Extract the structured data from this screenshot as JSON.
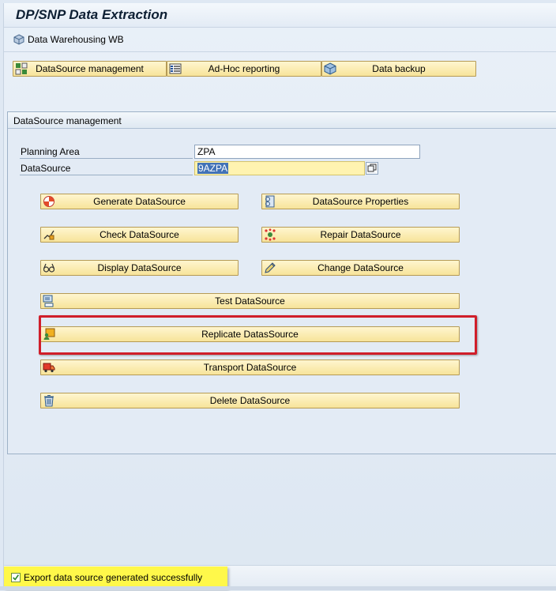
{
  "window": {
    "title": "DP/SNP Data Extraction"
  },
  "app_toolbar": {
    "dwb_label": "Data Warehousing WB"
  },
  "tabs": [
    {
      "label": "DataSource management",
      "icon": "datasource-management-icon"
    },
    {
      "label": "Ad-Hoc reporting",
      "icon": "report-list-icon"
    },
    {
      "label": "Data backup",
      "icon": "cube-icon"
    }
  ],
  "frame": {
    "title": "DataSource management",
    "planning_area": {
      "label": "Planning Area",
      "value": "ZPA"
    },
    "datasource": {
      "label": "DataSource",
      "value": "9AZPA"
    }
  },
  "buttons": {
    "generate": "Generate DataSource",
    "properties": "DataSource Properties",
    "check": "Check DataSource",
    "repair": "Repair DataSource",
    "display": "Display DataSource",
    "change": "Change DataSource",
    "test": "Test DataSource",
    "replicate": "Replicate DatasSource",
    "transport": "Transport DataSource",
    "delete": "Delete DataSource"
  },
  "status": {
    "message": "Export data source generated successfully"
  },
  "colors": {
    "button_fill": "#f7e49a",
    "highlight_box": "#d01e2a",
    "status_highlight": "#fff84a",
    "selection": "#4272b7"
  }
}
